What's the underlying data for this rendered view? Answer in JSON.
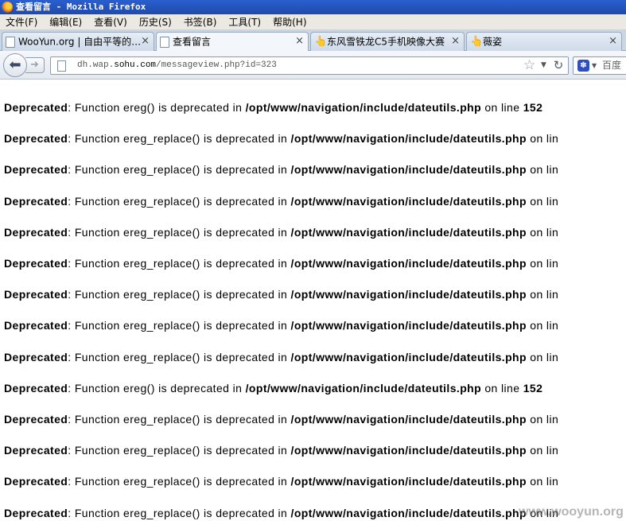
{
  "window": {
    "title": "查看留言 - Mozilla Firefox"
  },
  "menu": [
    "文件(F)",
    "编辑(E)",
    "查看(V)",
    "历史(S)",
    "书签(B)",
    "工具(T)",
    "帮助(H)"
  ],
  "tabs": [
    {
      "label": "WooYun.org | 自由平等的…",
      "icon": "page-icon",
      "active": false
    },
    {
      "label": "查看留言",
      "icon": "page-icon",
      "active": true
    },
    {
      "label": "东风雪铁龙C5手机映像大赛",
      "icon": "hand-icon",
      "active": false
    },
    {
      "label": "薇姿",
      "icon": "hand-icon",
      "active": false
    }
  ],
  "tab_close_glyph": "×",
  "nav": {
    "url_prefix": "dh.wap.",
    "url_domain": "sohu.com",
    "url_path": "/messageview.php?id=323",
    "search_placeholder": "百度"
  },
  "errors": [
    {
      "label": "Deprecated",
      "func": "ereg()",
      "path": "/opt/www/navigation/include/dateutils.php",
      "tail": "on line",
      "line": "152"
    },
    {
      "label": "Deprecated",
      "func": "ereg_replace()",
      "path": "/opt/www/navigation/include/dateutils.php",
      "tail": "on lin",
      "line": ""
    },
    {
      "label": "Deprecated",
      "func": "ereg_replace()",
      "path": "/opt/www/navigation/include/dateutils.php",
      "tail": "on lin",
      "line": ""
    },
    {
      "label": "Deprecated",
      "func": "ereg_replace()",
      "path": "/opt/www/navigation/include/dateutils.php",
      "tail": "on lin",
      "line": ""
    },
    {
      "label": "Deprecated",
      "func": "ereg_replace()",
      "path": "/opt/www/navigation/include/dateutils.php",
      "tail": "on lin",
      "line": ""
    },
    {
      "label": "Deprecated",
      "func": "ereg_replace()",
      "path": "/opt/www/navigation/include/dateutils.php",
      "tail": "on lin",
      "line": ""
    },
    {
      "label": "Deprecated",
      "func": "ereg_replace()",
      "path": "/opt/www/navigation/include/dateutils.php",
      "tail": "on lin",
      "line": ""
    },
    {
      "label": "Deprecated",
      "func": "ereg_replace()",
      "path": "/opt/www/navigation/include/dateutils.php",
      "tail": "on lin",
      "line": ""
    },
    {
      "label": "Deprecated",
      "func": "ereg_replace()",
      "path": "/opt/www/navigation/include/dateutils.php",
      "tail": "on lin",
      "line": ""
    },
    {
      "label": "Deprecated",
      "func": "ereg()",
      "path": "/opt/www/navigation/include/dateutils.php",
      "tail": "on line",
      "line": "152"
    },
    {
      "label": "Deprecated",
      "func": "ereg_replace()",
      "path": "/opt/www/navigation/include/dateutils.php",
      "tail": "on lin",
      "line": ""
    },
    {
      "label": "Deprecated",
      "func": "ereg_replace()",
      "path": "/opt/www/navigation/include/dateutils.php",
      "tail": "on lin",
      "line": ""
    },
    {
      "label": "Deprecated",
      "func": "ereg_replace()",
      "path": "/opt/www/navigation/include/dateutils.php",
      "tail": "on lin",
      "line": ""
    },
    {
      "label": "Deprecated",
      "func": "ereg_replace()",
      "path": "/opt/www/navigation/include/dateutils.php",
      "tail": "on lin",
      "line": ""
    }
  ],
  "error_middle_text": "is deprecated in",
  "error_prefix_text": ": Function",
  "watermark": "www.wooyun.org"
}
